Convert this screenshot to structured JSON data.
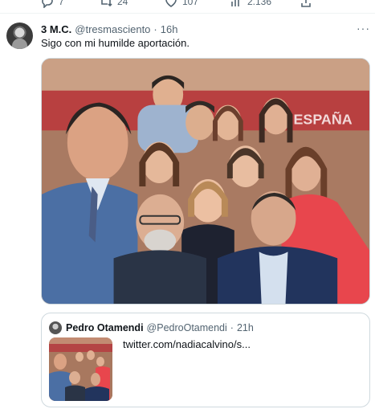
{
  "action_bar": {
    "reply_count": "7",
    "retweet_count": "24",
    "like_count": "107",
    "views_count": "2.136"
  },
  "tweet": {
    "author_name": "3 M.C.",
    "author_handle": "@tresmasciento",
    "separator": "·",
    "time": "16h",
    "text": "Sigo con mi humilde aportación.",
    "photo_sign_text": "ESPAÑA"
  },
  "quote": {
    "author_name": "Pedro Otamendi",
    "author_handle": "@PedroOtamendi",
    "separator": "·",
    "time": "21h",
    "link_text": "twitter.com/nadiacalvino/s..."
  },
  "icons": [
    "reply-icon",
    "retweet-icon",
    "like-icon",
    "views-icon",
    "share-icon",
    "more-icon"
  ]
}
